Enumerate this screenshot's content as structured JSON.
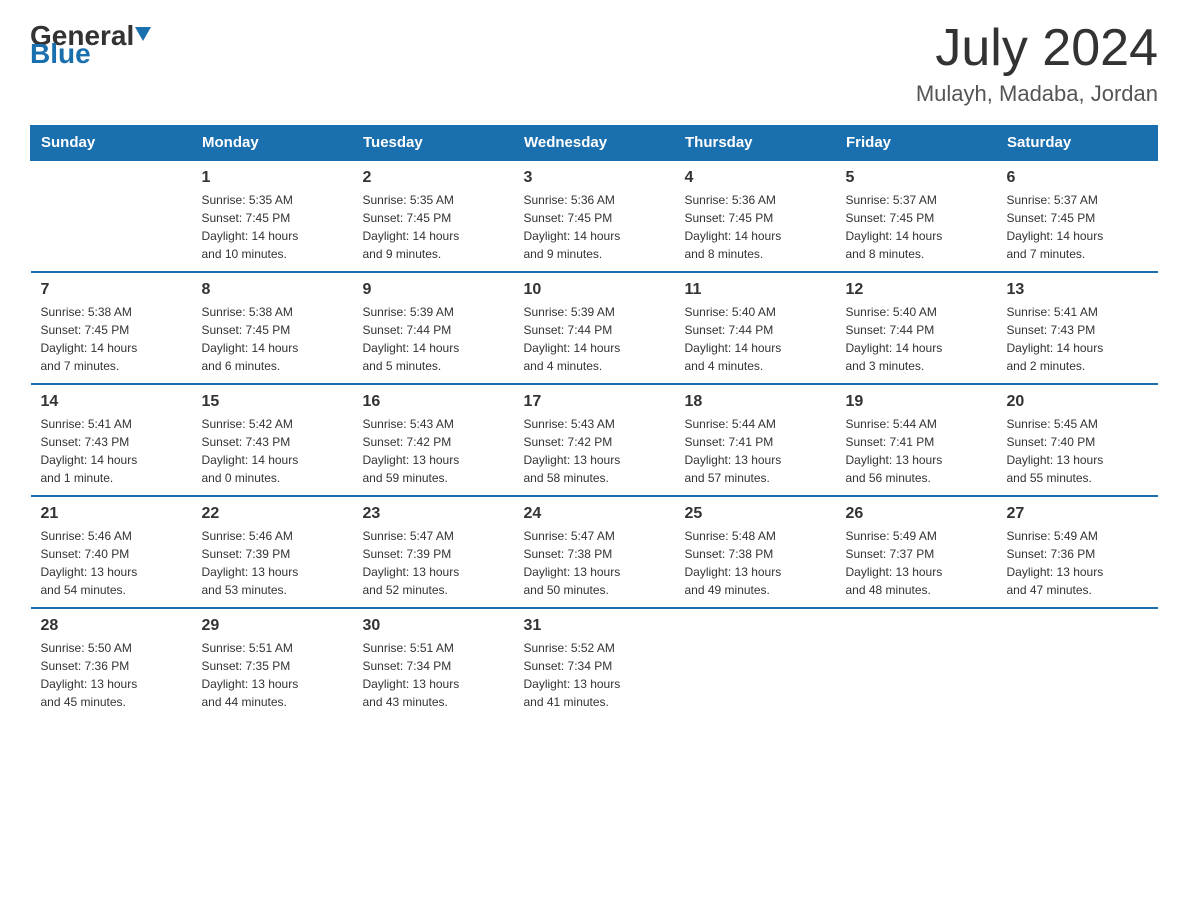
{
  "header": {
    "logo_general": "General",
    "logo_blue": "Blue",
    "month_year": "July 2024",
    "location": "Mulayh, Madaba, Jordan"
  },
  "days_of_week": [
    "Sunday",
    "Monday",
    "Tuesday",
    "Wednesday",
    "Thursday",
    "Friday",
    "Saturday"
  ],
  "weeks": [
    [
      {
        "day": "",
        "info": ""
      },
      {
        "day": "1",
        "info": "Sunrise: 5:35 AM\nSunset: 7:45 PM\nDaylight: 14 hours\nand 10 minutes."
      },
      {
        "day": "2",
        "info": "Sunrise: 5:35 AM\nSunset: 7:45 PM\nDaylight: 14 hours\nand 9 minutes."
      },
      {
        "day": "3",
        "info": "Sunrise: 5:36 AM\nSunset: 7:45 PM\nDaylight: 14 hours\nand 9 minutes."
      },
      {
        "day": "4",
        "info": "Sunrise: 5:36 AM\nSunset: 7:45 PM\nDaylight: 14 hours\nand 8 minutes."
      },
      {
        "day": "5",
        "info": "Sunrise: 5:37 AM\nSunset: 7:45 PM\nDaylight: 14 hours\nand 8 minutes."
      },
      {
        "day": "6",
        "info": "Sunrise: 5:37 AM\nSunset: 7:45 PM\nDaylight: 14 hours\nand 7 minutes."
      }
    ],
    [
      {
        "day": "7",
        "info": "Sunrise: 5:38 AM\nSunset: 7:45 PM\nDaylight: 14 hours\nand 7 minutes."
      },
      {
        "day": "8",
        "info": "Sunrise: 5:38 AM\nSunset: 7:45 PM\nDaylight: 14 hours\nand 6 minutes."
      },
      {
        "day": "9",
        "info": "Sunrise: 5:39 AM\nSunset: 7:44 PM\nDaylight: 14 hours\nand 5 minutes."
      },
      {
        "day": "10",
        "info": "Sunrise: 5:39 AM\nSunset: 7:44 PM\nDaylight: 14 hours\nand 4 minutes."
      },
      {
        "day": "11",
        "info": "Sunrise: 5:40 AM\nSunset: 7:44 PM\nDaylight: 14 hours\nand 4 minutes."
      },
      {
        "day": "12",
        "info": "Sunrise: 5:40 AM\nSunset: 7:44 PM\nDaylight: 14 hours\nand 3 minutes."
      },
      {
        "day": "13",
        "info": "Sunrise: 5:41 AM\nSunset: 7:43 PM\nDaylight: 14 hours\nand 2 minutes."
      }
    ],
    [
      {
        "day": "14",
        "info": "Sunrise: 5:41 AM\nSunset: 7:43 PM\nDaylight: 14 hours\nand 1 minute."
      },
      {
        "day": "15",
        "info": "Sunrise: 5:42 AM\nSunset: 7:43 PM\nDaylight: 14 hours\nand 0 minutes."
      },
      {
        "day": "16",
        "info": "Sunrise: 5:43 AM\nSunset: 7:42 PM\nDaylight: 13 hours\nand 59 minutes."
      },
      {
        "day": "17",
        "info": "Sunrise: 5:43 AM\nSunset: 7:42 PM\nDaylight: 13 hours\nand 58 minutes."
      },
      {
        "day": "18",
        "info": "Sunrise: 5:44 AM\nSunset: 7:41 PM\nDaylight: 13 hours\nand 57 minutes."
      },
      {
        "day": "19",
        "info": "Sunrise: 5:44 AM\nSunset: 7:41 PM\nDaylight: 13 hours\nand 56 minutes."
      },
      {
        "day": "20",
        "info": "Sunrise: 5:45 AM\nSunset: 7:40 PM\nDaylight: 13 hours\nand 55 minutes."
      }
    ],
    [
      {
        "day": "21",
        "info": "Sunrise: 5:46 AM\nSunset: 7:40 PM\nDaylight: 13 hours\nand 54 minutes."
      },
      {
        "day": "22",
        "info": "Sunrise: 5:46 AM\nSunset: 7:39 PM\nDaylight: 13 hours\nand 53 minutes."
      },
      {
        "day": "23",
        "info": "Sunrise: 5:47 AM\nSunset: 7:39 PM\nDaylight: 13 hours\nand 52 minutes."
      },
      {
        "day": "24",
        "info": "Sunrise: 5:47 AM\nSunset: 7:38 PM\nDaylight: 13 hours\nand 50 minutes."
      },
      {
        "day": "25",
        "info": "Sunrise: 5:48 AM\nSunset: 7:38 PM\nDaylight: 13 hours\nand 49 minutes."
      },
      {
        "day": "26",
        "info": "Sunrise: 5:49 AM\nSunset: 7:37 PM\nDaylight: 13 hours\nand 48 minutes."
      },
      {
        "day": "27",
        "info": "Sunrise: 5:49 AM\nSunset: 7:36 PM\nDaylight: 13 hours\nand 47 minutes."
      }
    ],
    [
      {
        "day": "28",
        "info": "Sunrise: 5:50 AM\nSunset: 7:36 PM\nDaylight: 13 hours\nand 45 minutes."
      },
      {
        "day": "29",
        "info": "Sunrise: 5:51 AM\nSunset: 7:35 PM\nDaylight: 13 hours\nand 44 minutes."
      },
      {
        "day": "30",
        "info": "Sunrise: 5:51 AM\nSunset: 7:34 PM\nDaylight: 13 hours\nand 43 minutes."
      },
      {
        "day": "31",
        "info": "Sunrise: 5:52 AM\nSunset: 7:34 PM\nDaylight: 13 hours\nand 41 minutes."
      },
      {
        "day": "",
        "info": ""
      },
      {
        "day": "",
        "info": ""
      },
      {
        "day": "",
        "info": ""
      }
    ]
  ]
}
